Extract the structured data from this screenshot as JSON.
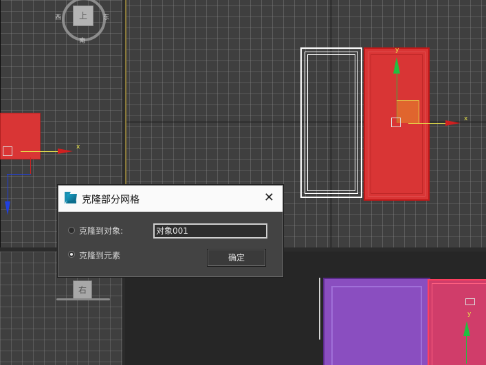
{
  "dialog": {
    "title": "克隆部分网格",
    "close_symbol": "✕",
    "option_object": "克隆到对象:",
    "option_element": "克隆到元素",
    "selected_option": "element",
    "object_name_value": "对象001",
    "ok_label": "确定",
    "icon": "3ds-max-app-icon"
  },
  "viewcube_top": {
    "center": "上",
    "west": "西",
    "east": "东",
    "south": "南"
  },
  "viewcube_left": {
    "center": "右"
  },
  "gizmo": {
    "x_label": "x",
    "y_label": "y",
    "x_color": "#e02020",
    "y_color": "#20c040",
    "z_color": "#2040e0"
  },
  "colors": {
    "selected_red": "#d93535",
    "purple": "#8a4ec0",
    "pink": "#d03d6a",
    "viewport_bg": "#3f3f3f"
  }
}
